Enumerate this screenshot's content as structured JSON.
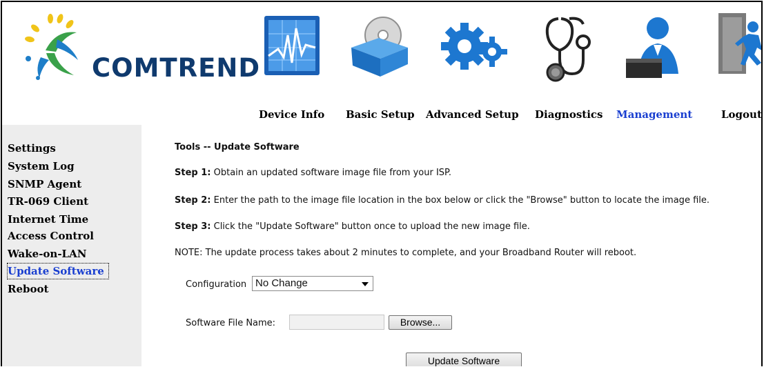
{
  "brand": {
    "name": "COMTREND"
  },
  "nav": [
    {
      "label": "Device Info",
      "icon": "chart-icon"
    },
    {
      "label": "Basic Setup",
      "icon": "disc-box-icon"
    },
    {
      "label": "Advanced Setup",
      "icon": "gears-icon"
    },
    {
      "label": "Diagnostics",
      "icon": "stethoscope-icon"
    },
    {
      "label": "Management",
      "icon": "user-laptop-icon",
      "active": true
    },
    {
      "label": "Logout",
      "icon": "exit-door-icon"
    }
  ],
  "sidebar": {
    "items": [
      {
        "label": "Settings"
      },
      {
        "label": "System Log"
      },
      {
        "label": "SNMP Agent"
      },
      {
        "label": "TR-069 Client"
      },
      {
        "label": "Internet Time"
      },
      {
        "label": "Access Control"
      },
      {
        "label": "Wake-on-LAN"
      },
      {
        "label": "Update Software",
        "active": true
      },
      {
        "label": "Reboot"
      }
    ]
  },
  "main": {
    "title": "Tools -- Update Software",
    "step1_label": "Step 1:",
    "step1_text": " Obtain an updated software image file from your ISP.",
    "step2_label": "Step 2:",
    "step2_text": " Enter the path to the image file location in the box below or click the \"Browse\" button to locate the image file.",
    "step3_label": "Step 3:",
    "step3_text": " Click the \"Update Software\" button once to upload the new image file.",
    "note": "NOTE: The update process takes about 2 minutes to complete, and your Broadband Router will reboot.",
    "config_label": "Configuration",
    "config_value": "No Change",
    "file_label": "Software File Name:",
    "file_value": "",
    "browse_label": "Browse...",
    "update_label": "Update Software"
  },
  "colors": {
    "active": "#1a3fd0",
    "sidebar_bg": "#ededed",
    "brand": "#0f3a6e"
  }
}
